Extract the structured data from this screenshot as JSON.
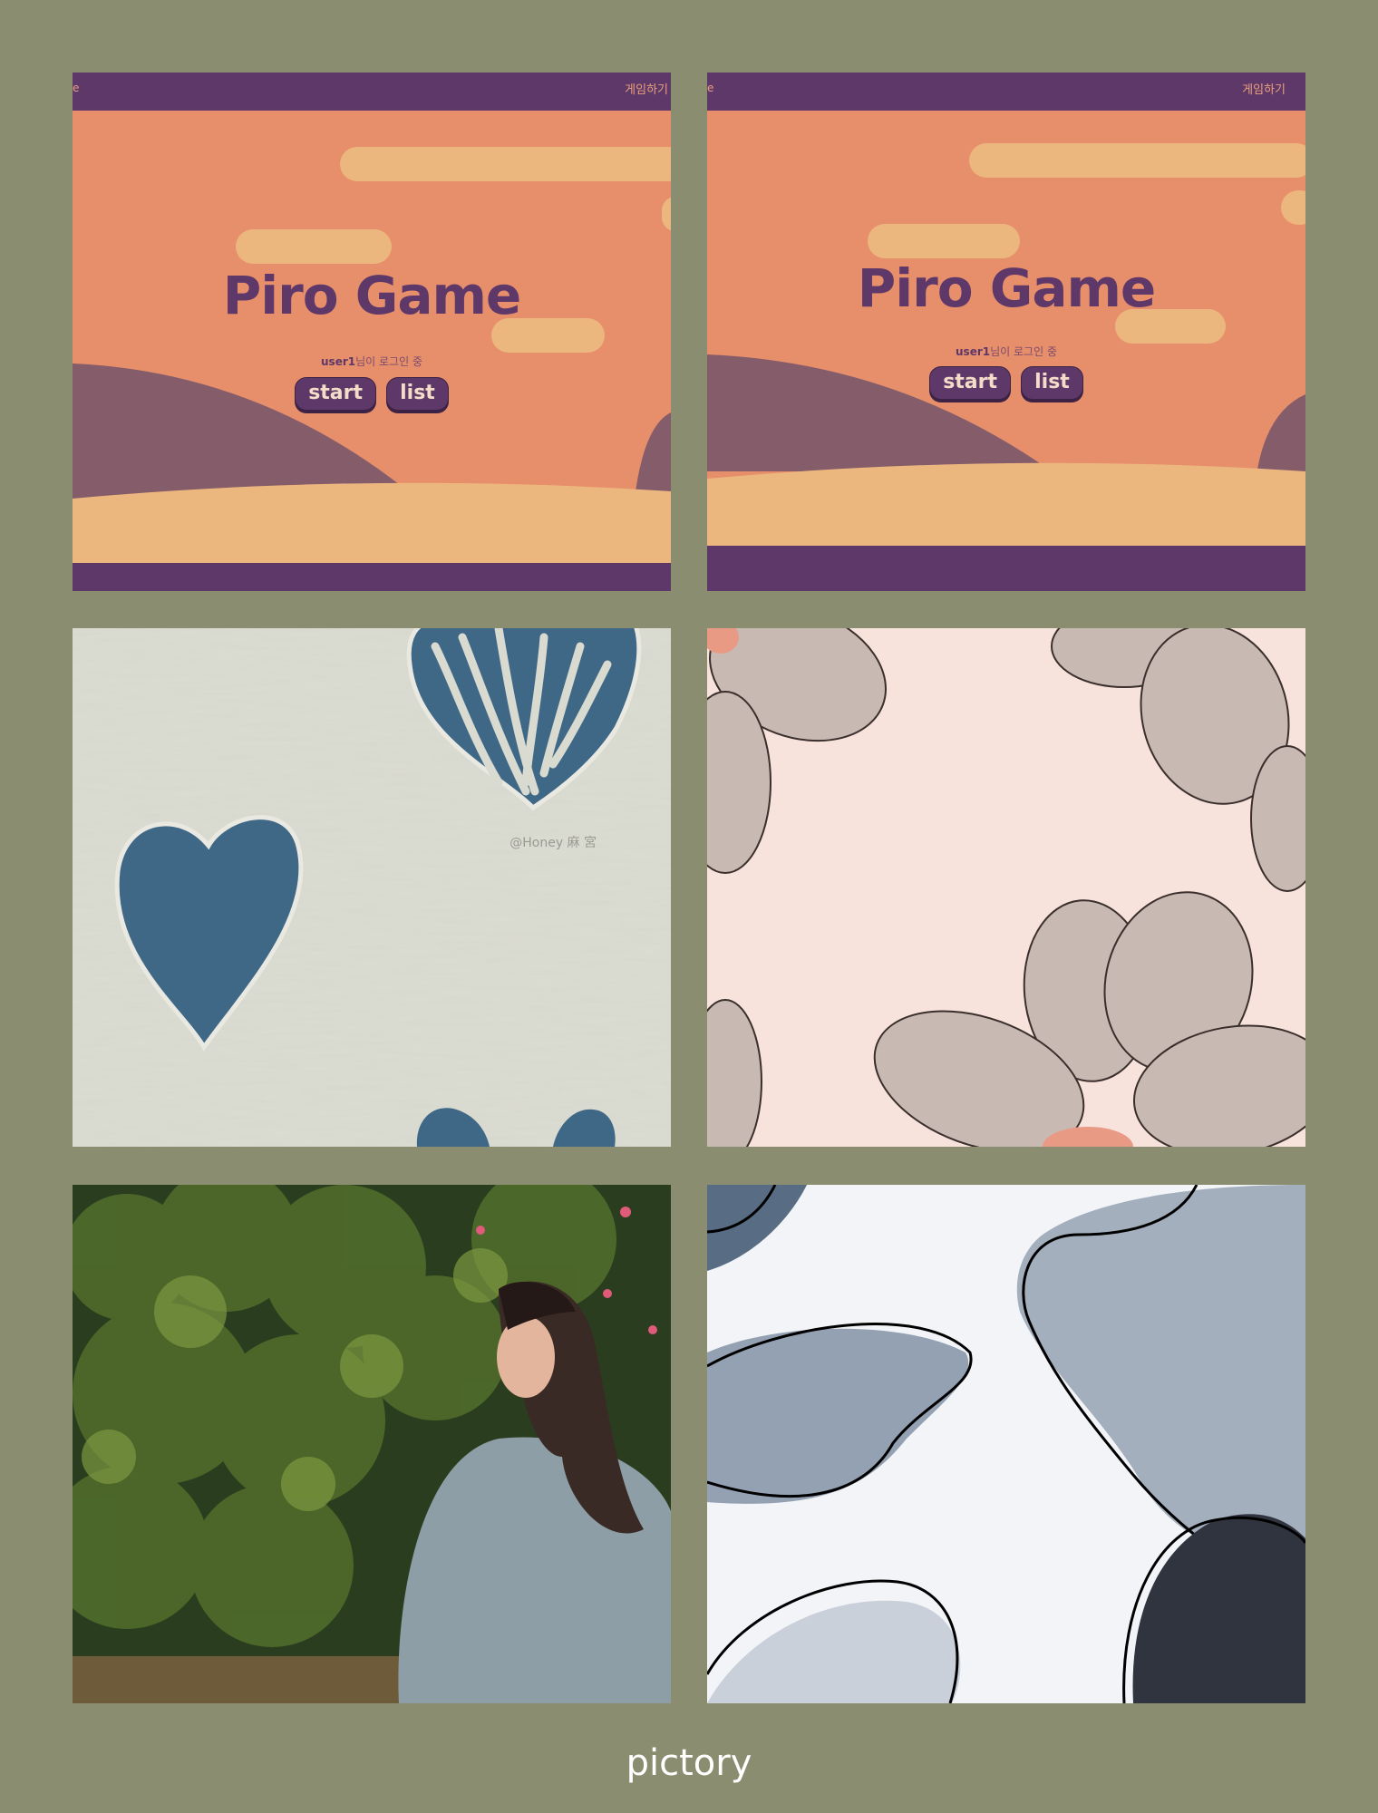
{
  "gallery": {
    "caption": "pictory",
    "items": [
      {
        "kind": "game-screenshot",
        "header_fragment": "e",
        "nav_label": "게임하기",
        "title": "Piro Game",
        "login_user": "user1",
        "login_suffix": "님이 로그인 중",
        "buttons": [
          "start",
          "list"
        ]
      },
      {
        "kind": "game-screenshot",
        "header_fragment": "e",
        "nav_label": "게임하기",
        "title": "Piro Game",
        "login_user": "user1",
        "login_suffix": "님이 로그인 중",
        "buttons": [
          "start",
          "list"
        ]
      },
      {
        "kind": "heart-texture",
        "watermark": "@Honey 麻 宮"
      },
      {
        "kind": "flower-texture"
      },
      {
        "kind": "portrait-photo"
      },
      {
        "kind": "abstract-shapes"
      }
    ]
  },
  "colors": {
    "page_background": "#8a8d70",
    "game_orange": "#e78f6a",
    "game_purple": "#5e3869",
    "game_sand": "#ecb67f",
    "heart_blue": "#3f6786",
    "flower_beige": "#c9b9b3",
    "abstract_slate": "#a4afbd",
    "abstract_dark": "#2f343f"
  }
}
